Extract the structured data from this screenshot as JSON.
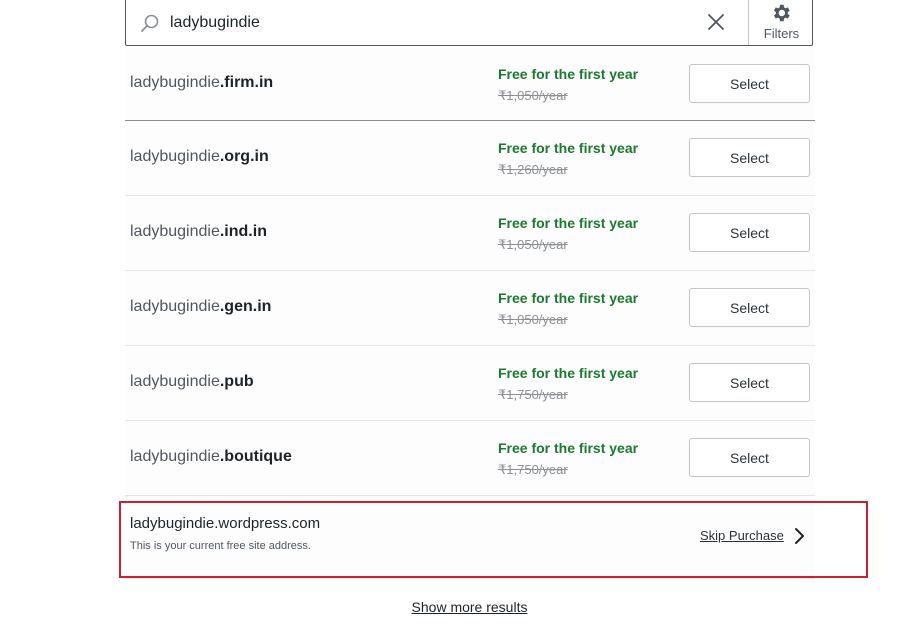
{
  "search": {
    "value": "ladybugindie",
    "filters_label": "Filters"
  },
  "results": [
    {
      "name": "ladybugindie",
      "tld": ".firm.in",
      "promo": "Free for the first year",
      "price": "₹1,050/year",
      "select_label": "Select"
    },
    {
      "name": "ladybugindie",
      "tld": ".org.in",
      "promo": "Free for the first year",
      "price": "₹1,260/year",
      "select_label": "Select"
    },
    {
      "name": "ladybugindie",
      "tld": ".ind.in",
      "promo": "Free for the first year",
      "price": "₹1,050/year",
      "select_label": "Select"
    },
    {
      "name": "ladybugindie",
      "tld": ".gen.in",
      "promo": "Free for the first year",
      "price": "₹1,050/year",
      "select_label": "Select"
    },
    {
      "name": "ladybugindie",
      "tld": ".pub",
      "promo": "Free for the first year",
      "price": "₹1,750/year",
      "select_label": "Select"
    },
    {
      "name": "ladybugindie",
      "tld": ".boutique",
      "promo": "Free for the first year",
      "price": "₹1,750/year",
      "select_label": "Select"
    }
  ],
  "current_address": {
    "domain": "ladybugindie.wordpress.com",
    "note": "This is your current free site address.",
    "skip_label": "Skip Purchase"
  },
  "show_more_label": "Show more results",
  "colors": {
    "promo_green": "#1a7a2e",
    "highlight_red": "#cc2030"
  },
  "icons": {
    "search": "search-icon",
    "clear": "close-icon",
    "filters": "gear-icon",
    "skip": "chevron-right-icon"
  }
}
